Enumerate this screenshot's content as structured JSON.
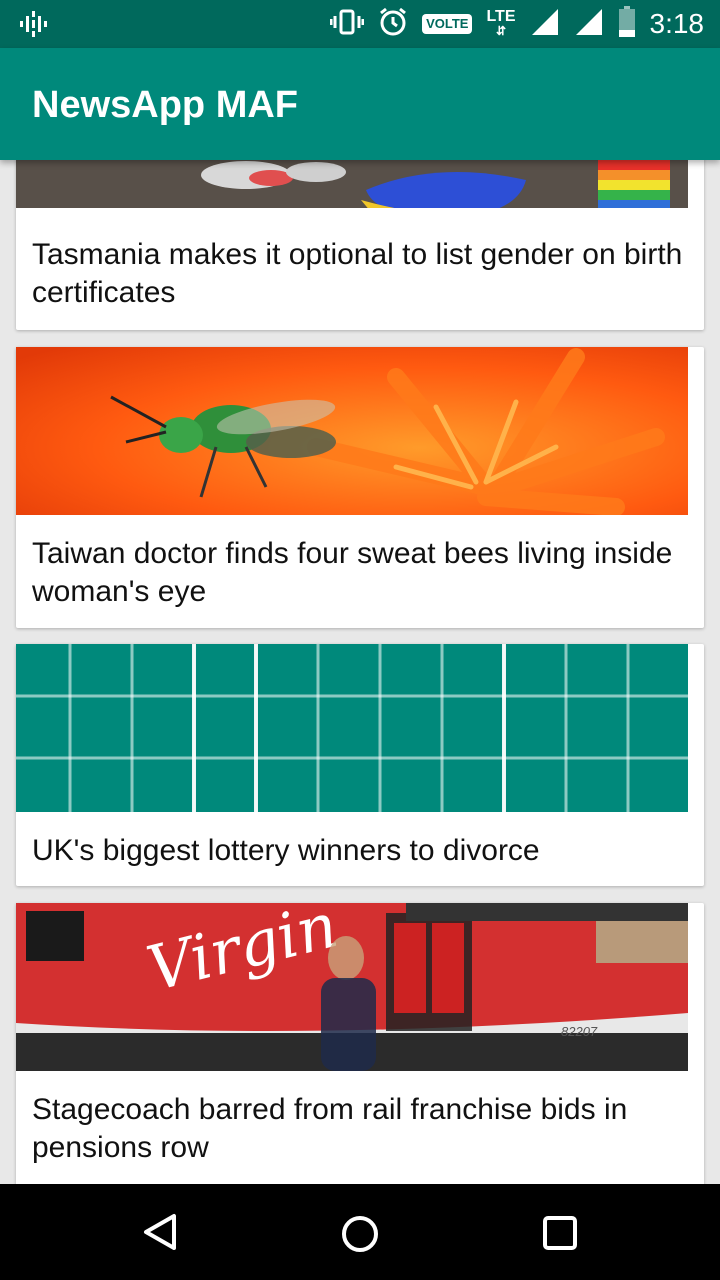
{
  "status_bar": {
    "time": "3:18",
    "volte": "VOLTE",
    "lte": "LTE",
    "icons": [
      "podcast-icon",
      "vibrate-icon",
      "alarm-icon",
      "volte-icon",
      "lte-icon",
      "signal-icon",
      "signal-icon",
      "battery-icon"
    ]
  },
  "app_bar": {
    "title": "NewsApp MAF"
  },
  "articles": [
    {
      "headline": "Tasmania makes it optional to list gender on birth certificates",
      "image": "sneakers-photo"
    },
    {
      "headline": "Taiwan doctor finds four sweat bees living inside woman's eye",
      "image": "sweat-bee-photo"
    },
    {
      "headline": "UK's biggest lottery winners to divorce",
      "image": "placeholder-grid"
    },
    {
      "headline": "Stagecoach barred from rail franchise bids in pensions row",
      "image": "virgin-train-photo"
    }
  ],
  "train_text": {
    "brand": "Virgin",
    "number": "82207"
  },
  "colors": {
    "status_bar": "#00695c",
    "app_bar": "#00897b",
    "placeholder": "#00897b",
    "background": "#e8e8e8"
  },
  "nav_bar": {
    "icons": [
      "back-icon",
      "home-icon",
      "recents-icon"
    ]
  }
}
